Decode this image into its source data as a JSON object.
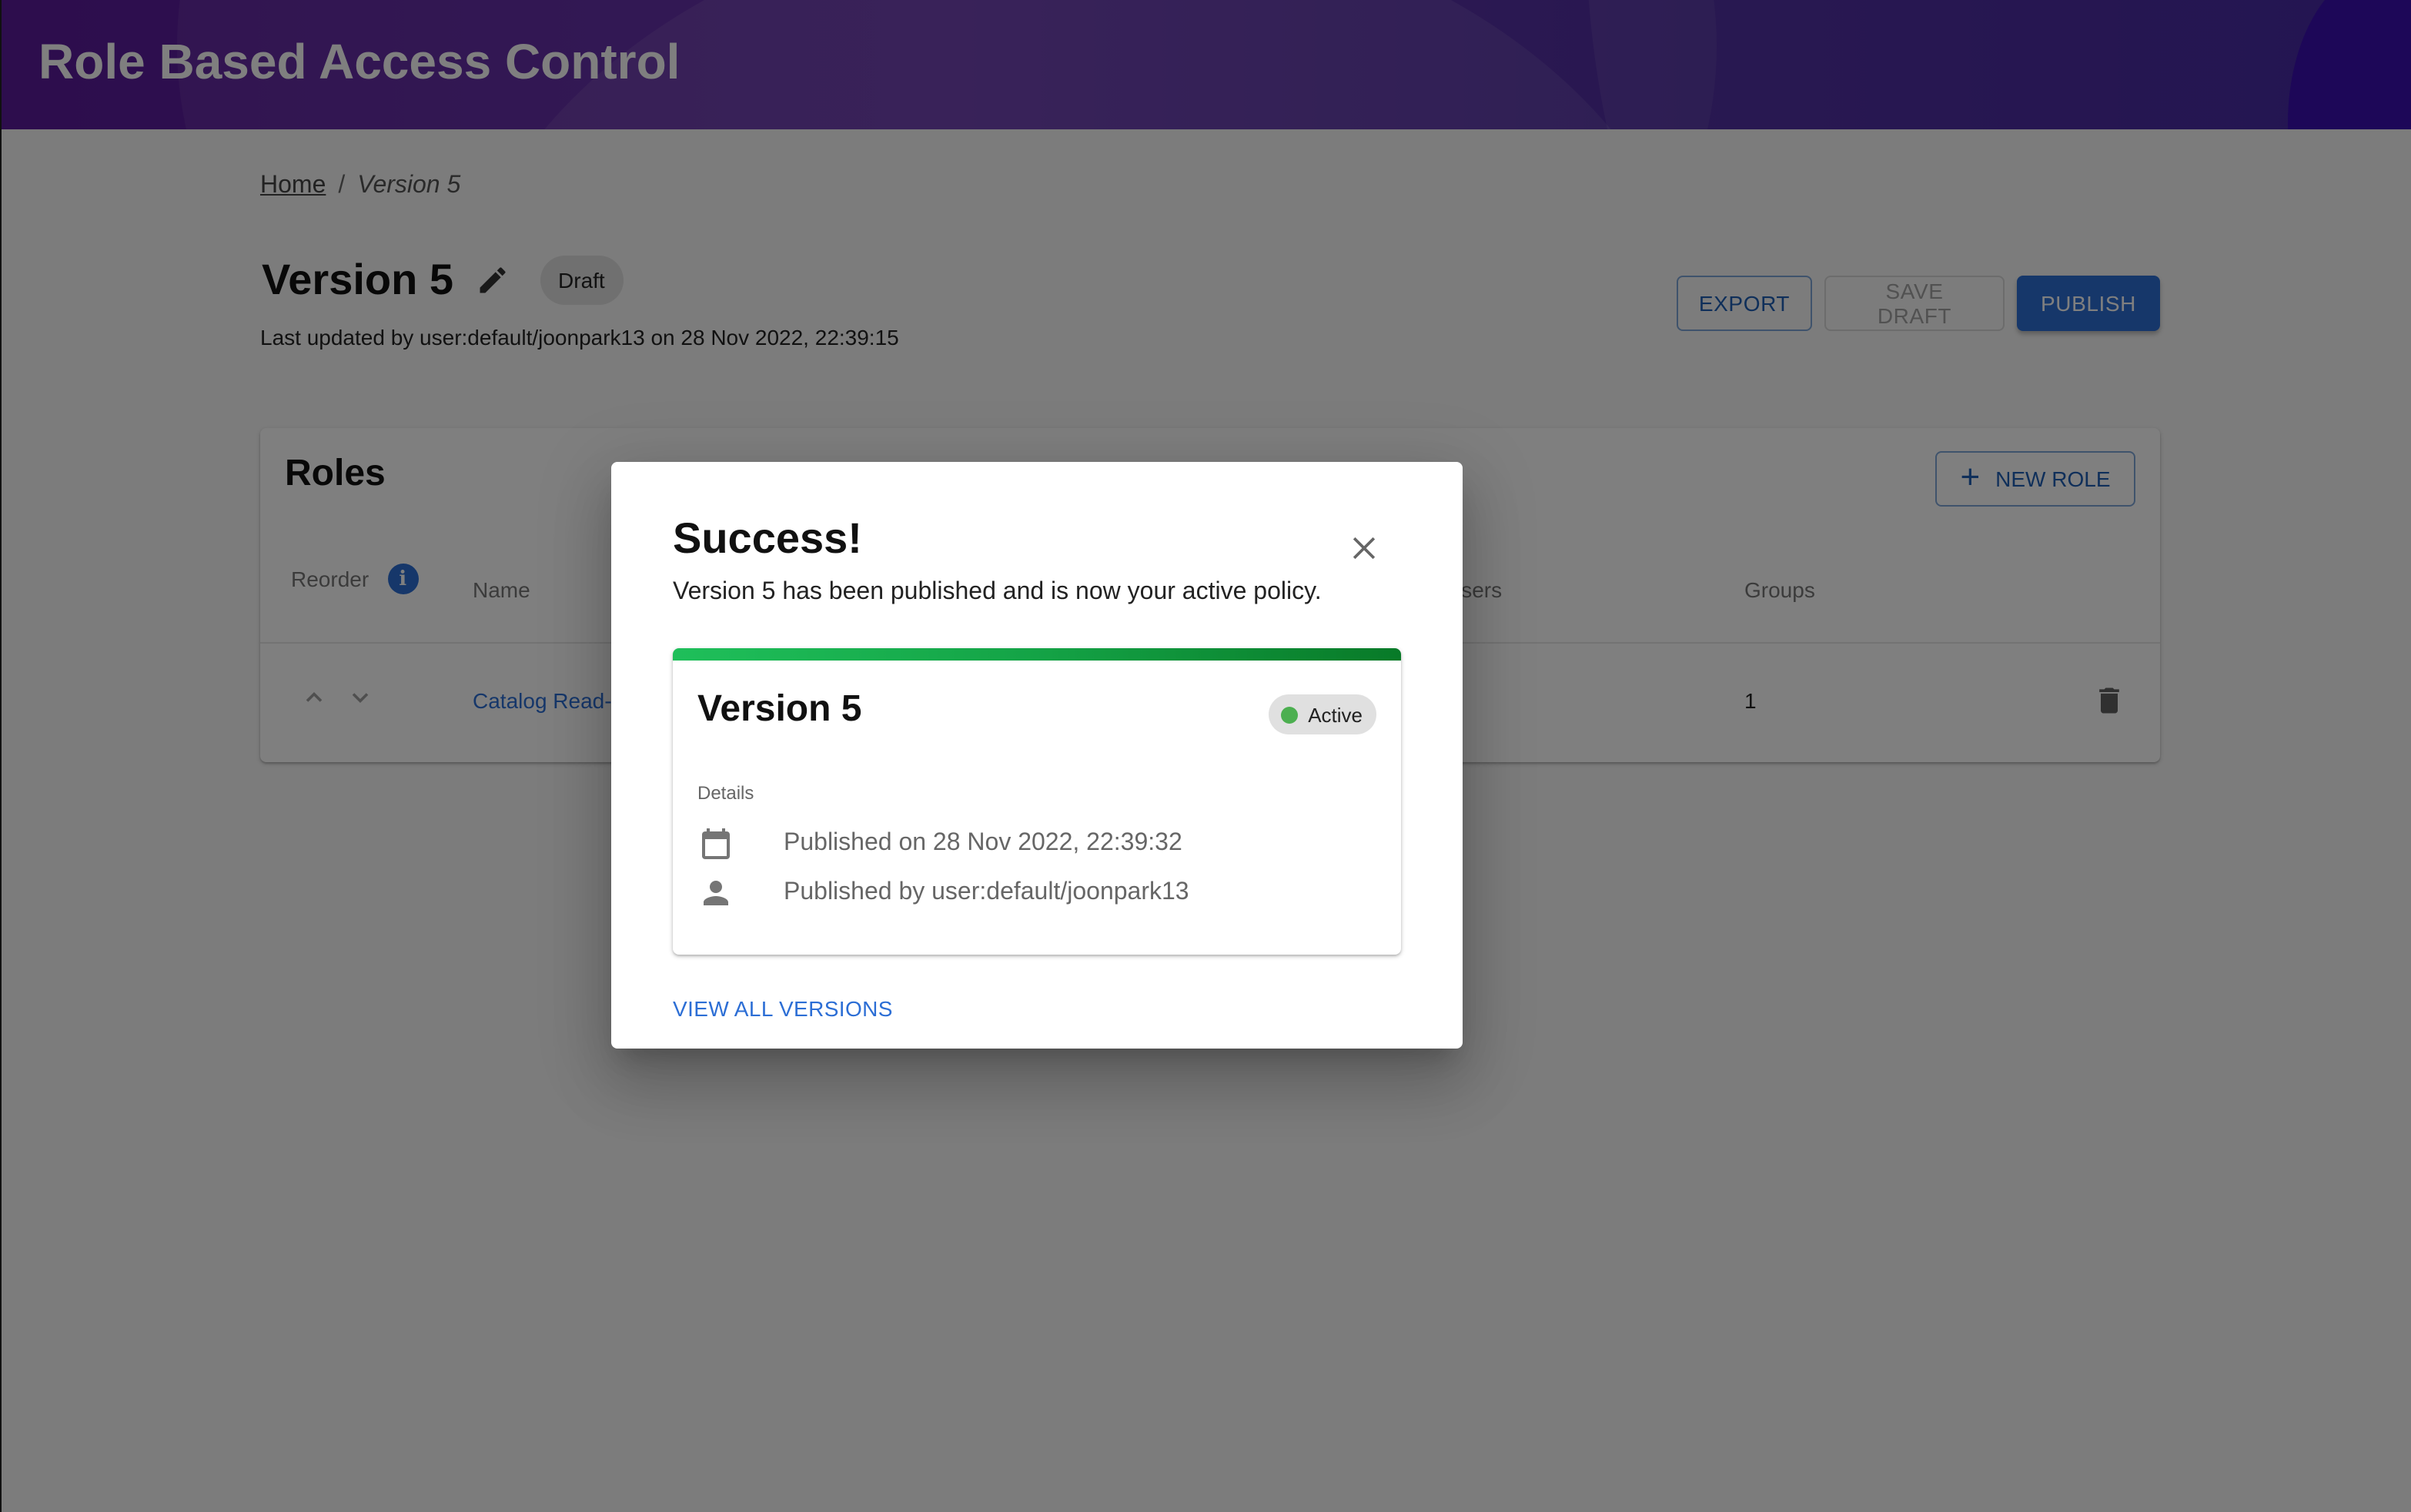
{
  "header": {
    "app_title": "Role Based Access Control"
  },
  "breadcrumb": {
    "home": "Home",
    "separator": "/",
    "current": "Version 5"
  },
  "page": {
    "title": "Version 5",
    "status_chip": "Draft",
    "last_updated": "Last updated by user:default/joonpark13 on 28 Nov 2022, 22:39:15",
    "edit_icon": "pencil-icon"
  },
  "toolbar": {
    "export_label": "EXPORT",
    "save_draft_label": "SAVE DRAFT",
    "save_draft_disabled": true,
    "publish_label": "PUBLISH"
  },
  "roles": {
    "title": "Roles",
    "new_role_label": "NEW ROLE",
    "columns": {
      "reorder": "Reorder",
      "name": "Name",
      "users": "Users",
      "groups": "Groups"
    },
    "rows": [
      {
        "name": "Catalog Read-",
        "users": "",
        "groups": "1"
      }
    ]
  },
  "modal": {
    "title": "Success!",
    "message": "Version 5 has been published and is now your active policy.",
    "card": {
      "title": "Version 5",
      "status": "Active",
      "status_color": "#4caf50",
      "details_label": "Details",
      "published_on": "Published on 28 Nov 2022, 22:39:32",
      "published_by": "Published by user:default/joonpark13"
    },
    "view_all_label": "VIEW ALL VERSIONS"
  },
  "colors": {
    "primary": "#2c6ed5",
    "header_gradient_start": "#5a1a9a",
    "header_gradient_end": "#3a1a9e",
    "success_bar": "#14a346"
  }
}
